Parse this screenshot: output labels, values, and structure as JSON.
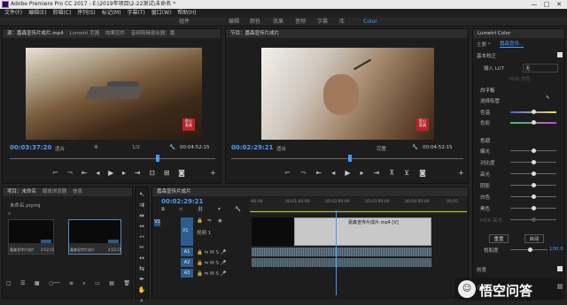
{
  "window": {
    "title": "Adobe Premiere Pro CC 2017 - E:\\2019年项目\\2-22测试\\未命名 *",
    "controls": [
      "—",
      "□",
      "✕"
    ]
  },
  "menu": [
    "文件(F)",
    "编辑(E)",
    "剪辑(C)",
    "序列(S)",
    "标记(M)",
    "字幕(T)",
    "窗口(W)",
    "帮助(H)"
  ],
  "workspaces": [
    "组件",
    "编辑",
    "颜色",
    "效果",
    "音频",
    "字幕",
    "库",
    "Color"
  ],
  "active_workspace": "Color",
  "source": {
    "tabs": [
      "源：嘉森宣传片成片.mp4",
      "Lumetri 范围",
      "效果控件",
      "音频剪辑混合器：嘉"
    ],
    "timecode": "00:03:37:20",
    "fit": "适合",
    "scale": "1/2",
    "duration": "00:04:52:15",
    "watermark": "匠心\n家具",
    "playhead": 0.72
  },
  "program": {
    "tabs": [
      "节目：嘉森宣传片成片"
    ],
    "timecode": "00:02:29:21",
    "fit": "适合",
    "quality": "完整",
    "duration": "00:04:52:15",
    "watermark": "匠心\n家具",
    "playhead": 0.51
  },
  "lumetri": {
    "title": "Lumetri Color",
    "sequence": "嘉森宣传...",
    "section_basic": "基本校正",
    "lut_label": "输入 LUT",
    "lut_value": "无",
    "hdr": "HDR 白色",
    "wb_section": "白平衡",
    "picker": "选择吸管",
    "wb_rows": [
      "色温",
      "色彩"
    ],
    "tone_section": "色调",
    "tone_rows": [
      "曝光",
      "对比度",
      "高光",
      "阴影",
      "白色",
      "黑色",
      "HDR 高光"
    ],
    "reset": "重置",
    "auto": "自动",
    "saturation": "饱和度",
    "saturation_value": "100.0",
    "creative": "创意",
    "curves": "曲线"
  },
  "project": {
    "tabs": [
      "项目：未命名",
      "媒体浏览器",
      "信息"
    ],
    "filename": "未命名.prproj",
    "items": [
      {
        "name": "嘉森宣传片成片",
        "dur": "4:52:15"
      },
      {
        "name": "嘉森宣传片成片",
        "dur": "4:52:15"
      }
    ]
  },
  "timeline": {
    "tab": "嘉森宣传片成片",
    "timecode": "00:02:29:21",
    "ruler": [
      ":00:00",
      "00:01:00:00",
      "00:02:00:00",
      "00:03:00:00",
      "00:04:00:00",
      "00:05"
    ],
    "tracks": [
      "V1",
      "A1",
      "A2",
      "A3"
    ],
    "track_label": "视频 1",
    "clip_name": "嘉森宣传片成片.mp4 [V]",
    "playhead": 0.47
  },
  "brand": "悟空问答"
}
